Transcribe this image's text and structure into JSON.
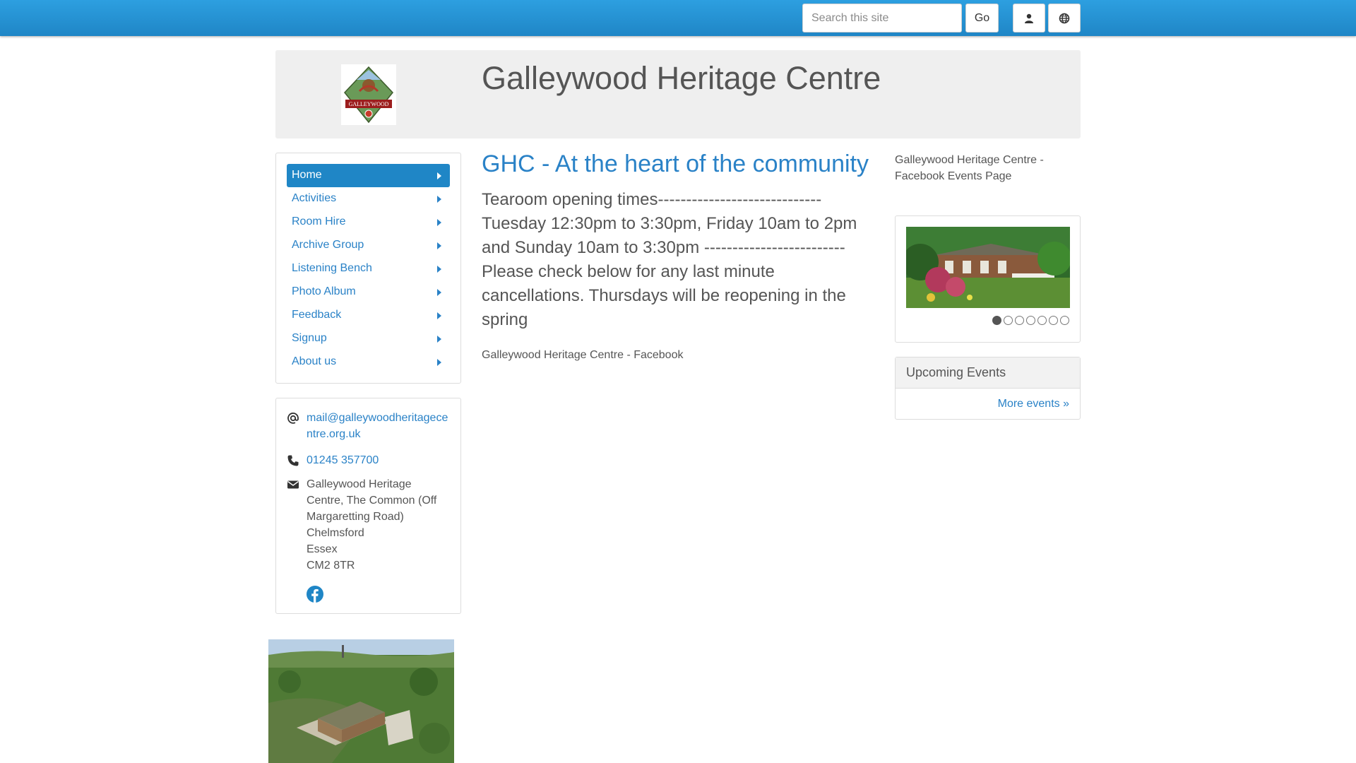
{
  "topbar": {
    "search_placeholder": "Search this site",
    "go_label": "Go",
    "user_icon": "user-icon",
    "language_icon": "globe-icon"
  },
  "header": {
    "title": "Galleywood Heritage Centre",
    "logo_text": "GALLEYWOOD"
  },
  "nav": {
    "items": [
      {
        "label": "Home",
        "active": true
      },
      {
        "label": "Activities"
      },
      {
        "label": "Room Hire"
      },
      {
        "label": "Archive Group"
      },
      {
        "label": "Listening Bench"
      },
      {
        "label": "Photo Album"
      },
      {
        "label": "Feedback"
      },
      {
        "label": "Signup"
      },
      {
        "label": "About us"
      }
    ]
  },
  "contact": {
    "email": "mail@galleywoodheritagecentre.org.uk",
    "phone": "01245 357700",
    "address": [
      "Galleywood Heritage Centre, The Common (Off Margaretting Road)",
      "Chelmsford",
      "Essex",
      "CM2 8TR"
    ],
    "social_icon": "facebook-icon"
  },
  "main": {
    "heading": "GHC - At the heart of the community",
    "body": "Tearoom opening times----------------------------- Tuesday 12:30pm to 3:30pm, Friday 10am to 2pm and Sunday 10am to 3:30pm ------------------------- Please check below for any last minute cancellations. Thursdays will be reopening in the spring",
    "facebook_caption": "Galleywood Heritage Centre - Facebook"
  },
  "sidebar_right": {
    "facebook_events_caption": "Galleywood Heritage Centre - Facebook Events Page",
    "slider": {
      "current": 1,
      "total": 7
    },
    "events": {
      "title": "Upcoming Events",
      "more_label": "More events »"
    }
  },
  "colors": {
    "topbar": "#1f86c6",
    "link": "#2a82c7",
    "active_nav": "#1f86c6",
    "text": "#555555"
  }
}
